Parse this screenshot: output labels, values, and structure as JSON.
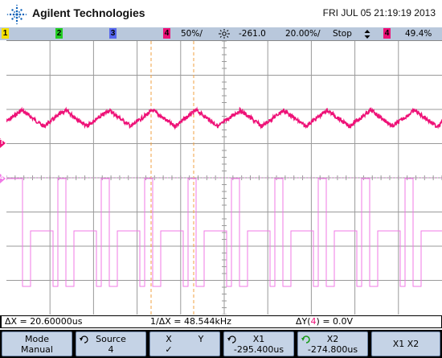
{
  "header": {
    "brand": "Agilent Technologies",
    "datetime": "FRI JUL 05 21:19:19 2013"
  },
  "status": {
    "channels": [
      {
        "num": "1",
        "color": "#f5e000"
      },
      {
        "num": "2",
        "color": "#22cc22"
      },
      {
        "num": "3",
        "color": "#3344ee"
      },
      {
        "num": "4",
        "color": "#ee1177"
      }
    ],
    "ch4_scale": "50%/",
    "delay": "-261.0",
    "timebase": "20.00š",
    "timebase_text": "20.00%/",
    "run_state": "Stop",
    "trigger_source": "4",
    "trigger_level": "49.4%"
  },
  "markers": {
    "ch4_label": "4",
    "trigger_label": "T"
  },
  "readouts": {
    "delta_x": "ΔX = 20.60000us",
    "inv_delta_x": "1/ΔX = 48.544kHz",
    "delta_y_prefix": "ΔY(",
    "delta_y_chan": "4",
    "delta_y_suffix": ") = 0.0V"
  },
  "softkeys": [
    {
      "line1": "Mode",
      "line2": "Manual"
    },
    {
      "line1": "Source",
      "line2": "4"
    },
    {
      "line1": "X",
      "line2": "✓",
      "line1b": "Y"
    },
    {
      "line1": "X1",
      "line2": "-295.400us"
    },
    {
      "line1": "X2",
      "line2": "-274.800us"
    },
    {
      "line1": "X1 X2",
      "line2": ""
    }
  ],
  "colors": {
    "ch4_trace": "#ee1177",
    "math_trace": "#f07ae6",
    "cursor": "#f0a040",
    "grid": "#9a9a9a"
  }
}
